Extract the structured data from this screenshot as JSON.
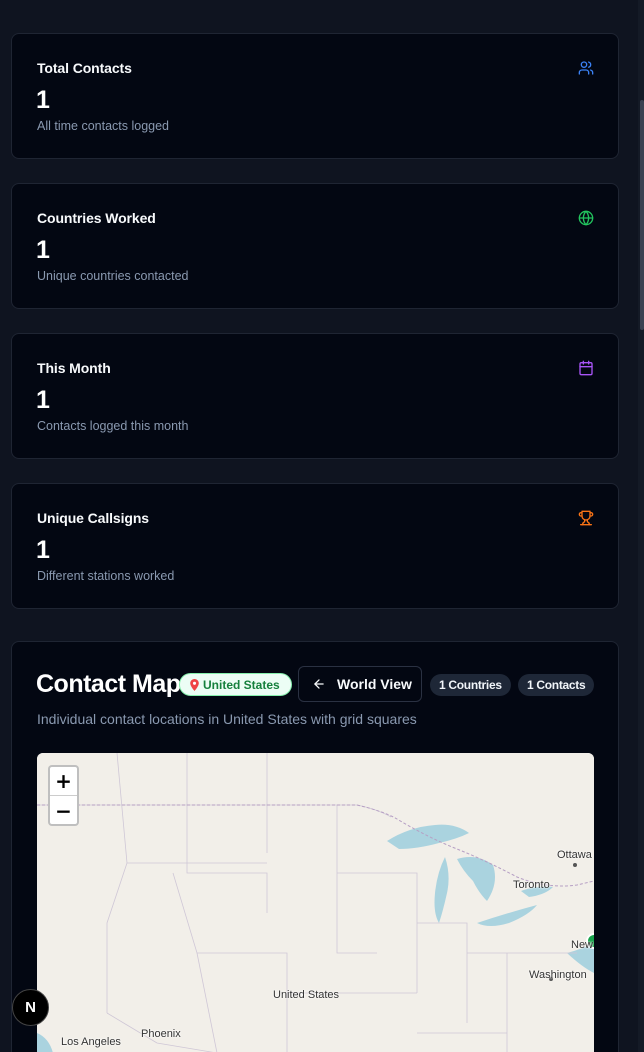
{
  "stats": [
    {
      "title": "Total Contacts",
      "value": "1",
      "subtitle": "All time contacts logged",
      "icon": "users-icon",
      "icon_color": "#3b82f6"
    },
    {
      "title": "Countries Worked",
      "value": "1",
      "subtitle": "Unique countries contacted",
      "icon": "globe-icon",
      "icon_color": "#22c55e"
    },
    {
      "title": "This Month",
      "value": "1",
      "subtitle": "Contacts logged this month",
      "icon": "calendar-icon",
      "icon_color": "#a855f7"
    },
    {
      "title": "Unique Callsigns",
      "value": "1",
      "subtitle": "Different stations worked",
      "icon": "trophy-icon",
      "icon_color": "#f97316"
    }
  ],
  "map": {
    "title": "Contact Map",
    "region_pill": "United States",
    "world_view_label": "World View",
    "countries_badge": "1 Countries",
    "contacts_badge": "1 Contacts",
    "subtitle": "Individual contact locations in United States with grid squares",
    "zoom_in": "+",
    "zoom_out": "−",
    "labels": {
      "ottawa": "Ottawa",
      "toronto": "Toronto",
      "new": "New",
      "washington": "Washington",
      "united_states": "United States",
      "phoenix": "Phoenix",
      "los_angeles": "Los Angeles"
    }
  },
  "dev_badge": "N",
  "colors": {
    "background": "#0f1420",
    "card": "#030712",
    "muted_text": "#8a99b0",
    "water": "#aad3df",
    "land": "#f2efe9"
  }
}
